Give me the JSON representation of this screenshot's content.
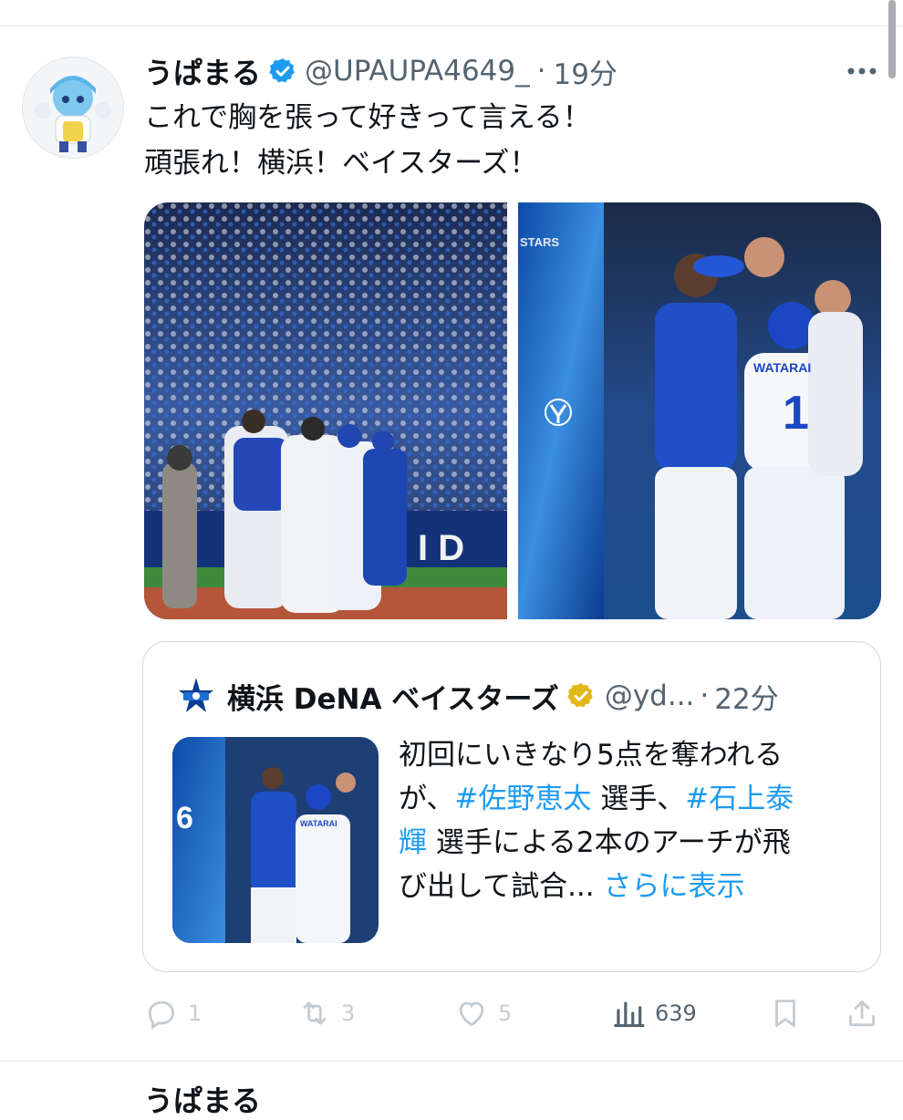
{
  "tweet": {
    "display_name": "うぱまる",
    "handle": "@UPAUPA4649_",
    "separator": "·",
    "time": "19分",
    "text_lines": [
      "これで胸を張って好きって言える！",
      "頑張れ！横浜！ベイスターズ！"
    ]
  },
  "photos": {
    "left_banner_letters": "I D",
    "right_jersey_name": "WATARAI",
    "right_jersey_number": "1",
    "right_logo_text": "STARS"
  },
  "quote": {
    "display_name": "横浜 DeNA ベイスターズ",
    "handle": "@yd...",
    "separator": "·",
    "time": "22分",
    "text_line1": "初回にいきなり5点を奪われる",
    "text_line2_a": "が、",
    "hashtag1": "#佐野恵太",
    "text_line2_b": " 選手、",
    "hashtag2a": "#石上泰",
    "hashtag2b": "輝",
    "text_line3": " 選手による2本のアーチが飛",
    "text_line4": "び出して試合...",
    "show_more": "さらに表示",
    "thumb_number": "6",
    "thumb_jersey": "WATARAI"
  },
  "actions": {
    "replies": "1",
    "retweets": "3",
    "likes": "5",
    "views": "639"
  },
  "next_tweet_name_peek": "うぱまる",
  "colors": {
    "accent": "#1d9bf0",
    "verified_blue": "#1d9bf0",
    "verified_gold": "#e2b719",
    "text": "#0f1419",
    "secondary": "#536471"
  }
}
